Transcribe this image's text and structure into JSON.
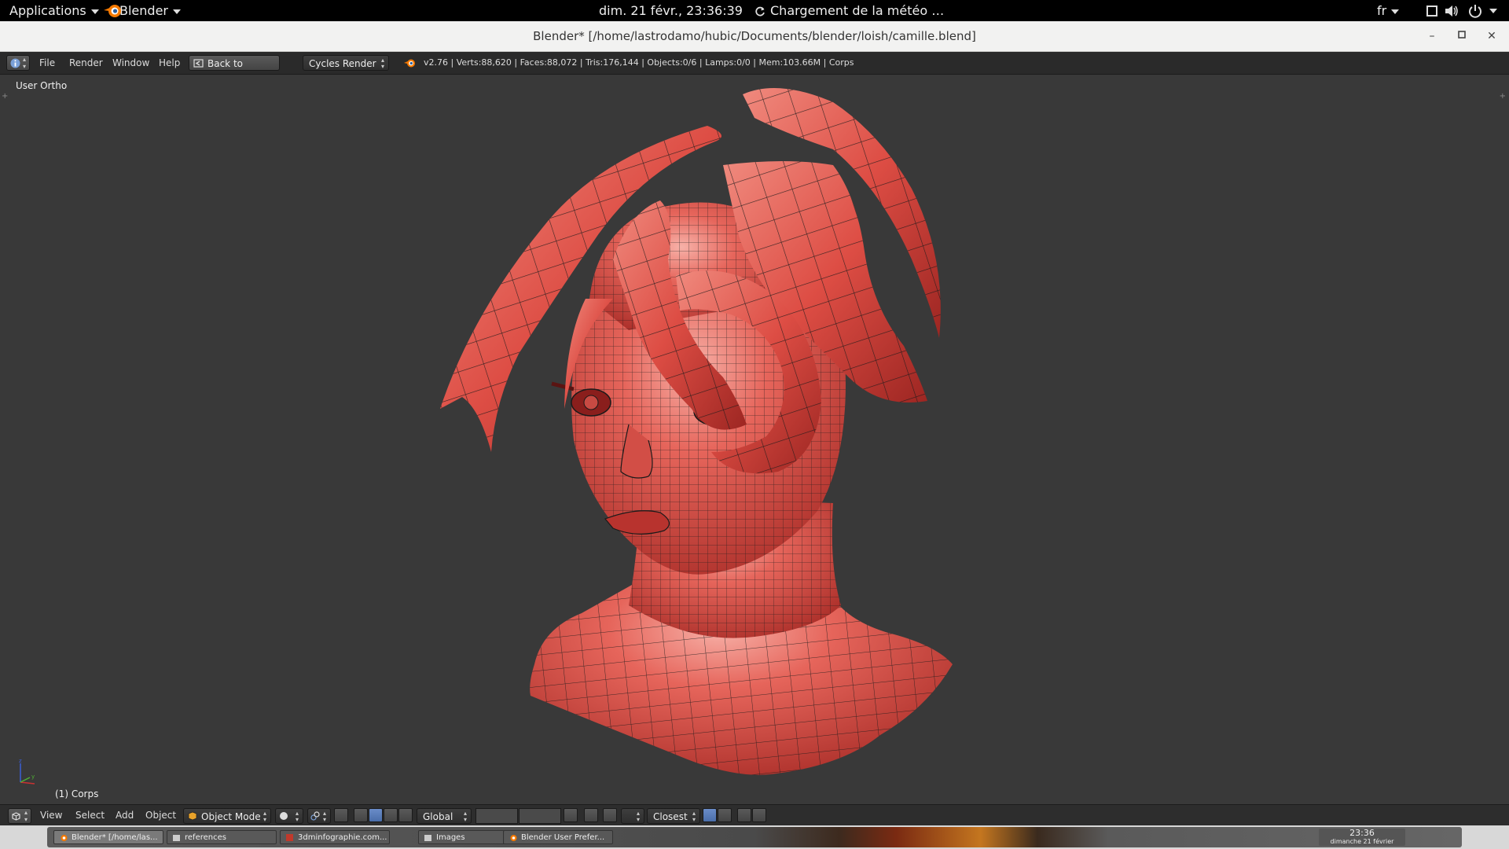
{
  "topbar": {
    "applications": "Applications",
    "app_menu": "Blender",
    "clock": "dim. 21 févr., 23:36:39",
    "weather": "Chargement de la météo …",
    "language": "fr"
  },
  "window": {
    "title": "Blender* [/home/lastrodamo/hubic/Documents/blender/loish/camille.blend]"
  },
  "header": {
    "menus": [
      "File",
      "Render",
      "Window",
      "Help"
    ],
    "back_button": "Back to Previous",
    "render_engine": "Cycles Render",
    "stats": "v2.76 | Verts:88,620 | Faces:88,072 | Tris:176,144 | Objects:0/6 | Lamps:0/0 | Mem:103.66M | Corps"
  },
  "viewport": {
    "view_label": "User Ortho",
    "object_label": "(1) Corps"
  },
  "bottom_header": {
    "menus": [
      "View",
      "Select",
      "Add",
      "Object"
    ],
    "mode": "Object Mode",
    "orientation": "Global",
    "snap_target": "Closest"
  },
  "taskbar": {
    "tasks": [
      "Blender* [/home/las...",
      "references",
      "3dminfographie.com...",
      "Images",
      "Blender User Prefer..."
    ],
    "time": "23:36",
    "date": "dimanche 21 février"
  },
  "colors": {
    "mesh": "#e0574f",
    "wire": "#1a1a1a",
    "viewport_bg": "#393939",
    "accent": "#f57900"
  }
}
